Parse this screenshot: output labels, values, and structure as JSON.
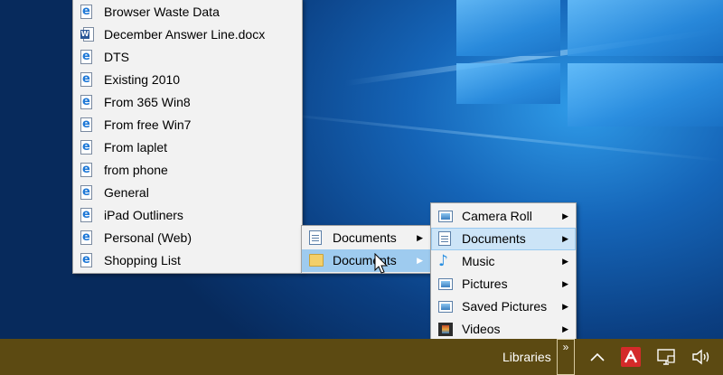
{
  "file_menu": {
    "items": [
      {
        "label": "Browser Waste Data",
        "icon": "edge-file-icon"
      },
      {
        "label": "December Answer Line.docx",
        "icon": "word-file-icon"
      },
      {
        "label": "DTS",
        "icon": "edge-file-icon"
      },
      {
        "label": "Existing 2010",
        "icon": "edge-file-icon"
      },
      {
        "label": "From 365 Win8",
        "icon": "edge-file-icon"
      },
      {
        "label": "From free Win7",
        "icon": "edge-file-icon"
      },
      {
        "label": "From laplet",
        "icon": "edge-file-icon"
      },
      {
        "label": "from phone",
        "icon": "edge-file-icon"
      },
      {
        "label": "General",
        "icon": "edge-file-icon"
      },
      {
        "label": "iPad Outliners",
        "icon": "edge-file-icon"
      },
      {
        "label": "Personal (Web)",
        "icon": "edge-file-icon"
      },
      {
        "label": "Shopping List",
        "icon": "edge-file-icon"
      }
    ]
  },
  "documents_menu": {
    "items": [
      {
        "label": "Documents",
        "icon": "document-icon"
      },
      {
        "label": "Documents",
        "icon": "folder-icon"
      }
    ]
  },
  "libraries_menu": {
    "items": [
      {
        "label": "Camera Roll",
        "icon": "picture-icon"
      },
      {
        "label": "Documents",
        "icon": "document-icon"
      },
      {
        "label": "Music",
        "icon": "music-icon"
      },
      {
        "label": "Pictures",
        "icon": "picture-icon"
      },
      {
        "label": "Saved Pictures",
        "icon": "picture-icon"
      },
      {
        "label": "Videos",
        "icon": "video-icon"
      }
    ]
  },
  "taskbar": {
    "toolbar_label": "Libraries",
    "chevron": "»"
  },
  "colors": {
    "taskbar": "#5c4a12",
    "menu_bg": "#f2f2f2",
    "highlight": "#cce4f7"
  }
}
